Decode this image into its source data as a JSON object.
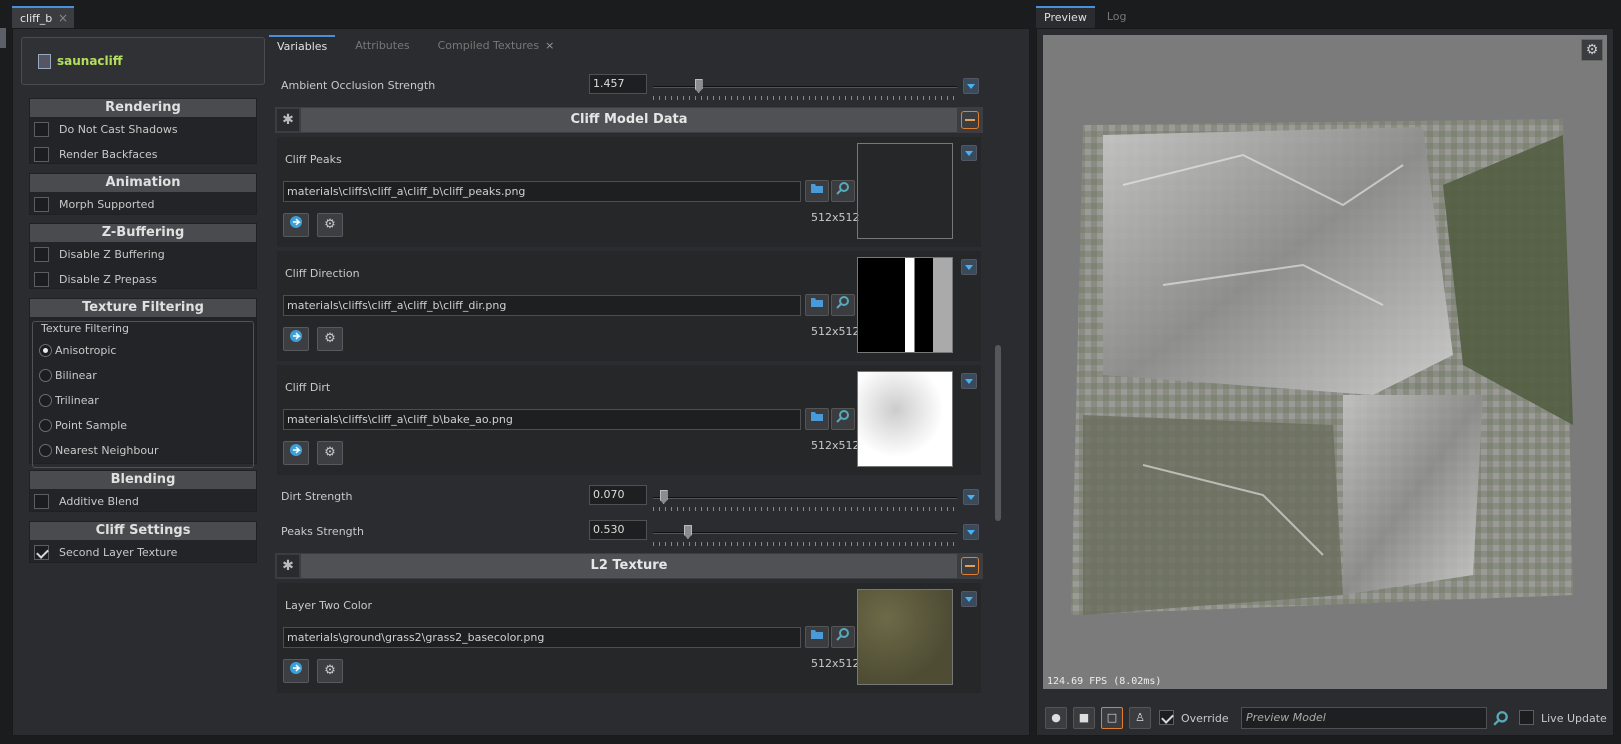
{
  "doc_tab": {
    "label": "cliff_b"
  },
  "asset": {
    "name": "saunacliff"
  },
  "sidebar": {
    "rendering": {
      "title": "Rendering",
      "items": [
        {
          "label": "Do Not Cast Shadows",
          "checked": false
        },
        {
          "label": "Render Backfaces",
          "checked": false
        }
      ]
    },
    "animation": {
      "title": "Animation",
      "items": [
        {
          "label": "Morph Supported",
          "checked": false
        }
      ]
    },
    "zbuffering": {
      "title": "Z-Buffering",
      "items": [
        {
          "label": "Disable Z Buffering",
          "checked": false
        },
        {
          "label": "Disable Z Prepass",
          "checked": false
        }
      ]
    },
    "texfilter": {
      "title": "Texture Filtering",
      "group_title": "Texture Filtering",
      "options": [
        "Anisotropic",
        "Bilinear",
        "Trilinear",
        "Point Sample",
        "Nearest Neighbour"
      ],
      "selected": "Anisotropic"
    },
    "blending": {
      "title": "Blending",
      "items": [
        {
          "label": "Additive Blend",
          "checked": false
        }
      ]
    },
    "cliffsettings": {
      "title": "Cliff Settings",
      "items": [
        {
          "label": "Second Layer Texture",
          "checked": true
        }
      ]
    }
  },
  "tabs": [
    {
      "label": "Variables",
      "active": true
    },
    {
      "label": "Attributes",
      "active": false
    },
    {
      "label": "Compiled Textures",
      "active": false
    }
  ],
  "vars": {
    "ao": {
      "label": "Ambient Occlusion Strength",
      "value": "1.457",
      "fraction": 0.15
    },
    "cat1": {
      "title": "Cliff Model Data"
    },
    "peaks": {
      "label": "Cliff Peaks",
      "path": "materials\\cliffs\\cliff_a\\cliff_b\\cliff_peaks.png",
      "res": "512x512"
    },
    "direction": {
      "label": "Cliff Direction",
      "path": "materials\\cliffs\\cliff_a\\cliff_b\\cliff_dir.png",
      "res": "512x512"
    },
    "dirt": {
      "label": "Cliff Dirt",
      "path": "materials\\cliffs\\cliff_a\\cliff_b\\bake_ao.png",
      "res": "512x512"
    },
    "dirt_strength": {
      "label": "Dirt Strength",
      "value": "0.070",
      "fraction": 0.035
    },
    "peaks_strength": {
      "label": "Peaks Strength",
      "value": "0.530",
      "fraction": 0.115
    },
    "cat2": {
      "title": "L2 Texture"
    },
    "layer2": {
      "label": "Layer Two Color",
      "path": "materials\\ground\\grass2\\grass2_basecolor.png",
      "res": "512x512"
    }
  },
  "preview_tabs": [
    {
      "label": "Preview",
      "active": true
    },
    {
      "label": "Log",
      "active": false
    }
  ],
  "preview": {
    "fps": "124.69 FPS (8.02ms)",
    "override_label": "Override",
    "override_checked": true,
    "model_placeholder": "Preview Model",
    "live_update_label": "Live Update",
    "live_update_checked": false
  },
  "icons": [
    "gear-icon",
    "folder-icon",
    "search-icon",
    "refresh-icon",
    "sphere-icon",
    "cube-icon",
    "plane-icon",
    "figure-icon"
  ]
}
